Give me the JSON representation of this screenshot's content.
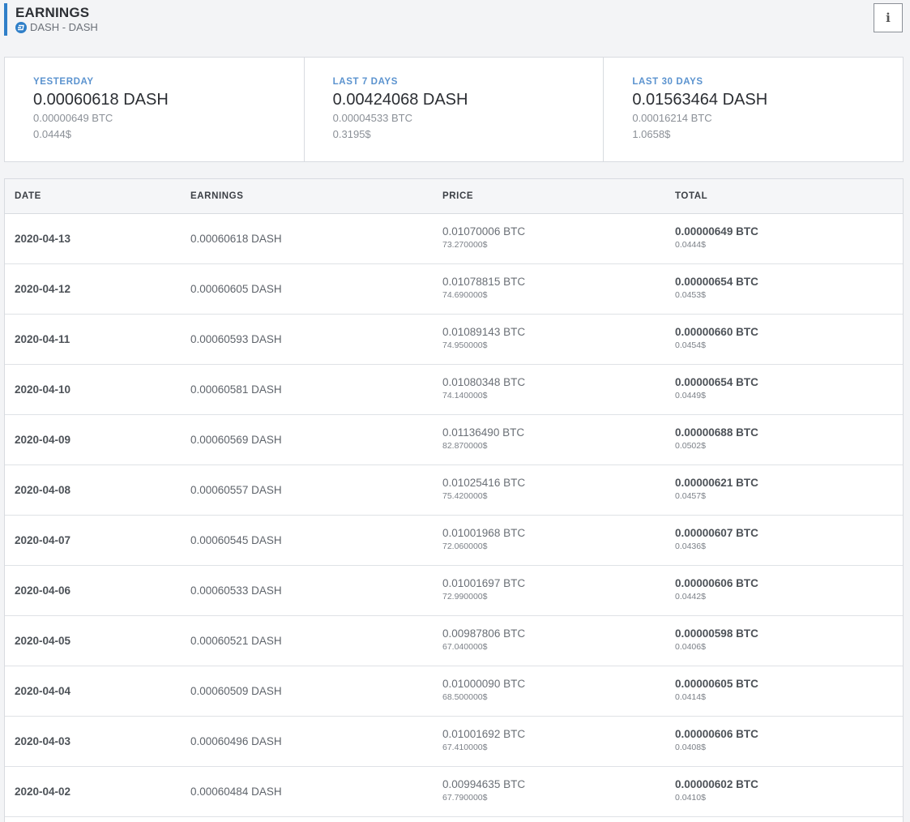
{
  "header": {
    "title": "EARNINGS",
    "subtitle": "DASH - DASH",
    "coin_icon": "dash-coin-icon",
    "info_label": "i",
    "accent_color": "#2f7fc8"
  },
  "stats": [
    {
      "label": "YESTERDAY",
      "amount": "0.00060618 DASH",
      "btc": "0.00000649 BTC",
      "usd": "0.0444$"
    },
    {
      "label": "LAST 7 DAYS",
      "amount": "0.00424068 DASH",
      "btc": "0.00004533 BTC",
      "usd": "0.3195$"
    },
    {
      "label": "LAST 30 DAYS",
      "amount": "0.01563464 DASH",
      "btc": "0.00016214 BTC",
      "usd": "1.0658$"
    }
  ],
  "table": {
    "columns": [
      "DATE",
      "EARNINGS",
      "PRICE",
      "TOTAL"
    ],
    "rows": [
      {
        "date": "2020-04-13",
        "earnings": "0.00060618 DASH",
        "price_btc": "0.01070006 BTC",
        "price_usd": "73.270000$",
        "total_btc": "0.00000649 BTC",
        "total_usd": "0.0444$"
      },
      {
        "date": "2020-04-12",
        "earnings": "0.00060605 DASH",
        "price_btc": "0.01078815 BTC",
        "price_usd": "74.690000$",
        "total_btc": "0.00000654 BTC",
        "total_usd": "0.0453$"
      },
      {
        "date": "2020-04-11",
        "earnings": "0.00060593 DASH",
        "price_btc": "0.01089143 BTC",
        "price_usd": "74.950000$",
        "total_btc": "0.00000660 BTC",
        "total_usd": "0.0454$"
      },
      {
        "date": "2020-04-10",
        "earnings": "0.00060581 DASH",
        "price_btc": "0.01080348 BTC",
        "price_usd": "74.140000$",
        "total_btc": "0.00000654 BTC",
        "total_usd": "0.0449$"
      },
      {
        "date": "2020-04-09",
        "earnings": "0.00060569 DASH",
        "price_btc": "0.01136490 BTC",
        "price_usd": "82.870000$",
        "total_btc": "0.00000688 BTC",
        "total_usd": "0.0502$"
      },
      {
        "date": "2020-04-08",
        "earnings": "0.00060557 DASH",
        "price_btc": "0.01025416 BTC",
        "price_usd": "75.420000$",
        "total_btc": "0.00000621 BTC",
        "total_usd": "0.0457$"
      },
      {
        "date": "2020-04-07",
        "earnings": "0.00060545 DASH",
        "price_btc": "0.01001968 BTC",
        "price_usd": "72.060000$",
        "total_btc": "0.00000607 BTC",
        "total_usd": "0.0436$"
      },
      {
        "date": "2020-04-06",
        "earnings": "0.00060533 DASH",
        "price_btc": "0.01001697 BTC",
        "price_usd": "72.990000$",
        "total_btc": "0.00000606 BTC",
        "total_usd": "0.0442$"
      },
      {
        "date": "2020-04-05",
        "earnings": "0.00060521 DASH",
        "price_btc": "0.00987806 BTC",
        "price_usd": "67.040000$",
        "total_btc": "0.00000598 BTC",
        "total_usd": "0.0406$"
      },
      {
        "date": "2020-04-04",
        "earnings": "0.00060509 DASH",
        "price_btc": "0.01000090 BTC",
        "price_usd": "68.500000$",
        "total_btc": "0.00000605 BTC",
        "total_usd": "0.0414$"
      },
      {
        "date": "2020-04-03",
        "earnings": "0.00060496 DASH",
        "price_btc": "0.01001692 BTC",
        "price_usd": "67.410000$",
        "total_btc": "0.00000606 BTC",
        "total_usd": "0.0408$"
      },
      {
        "date": "2020-04-02",
        "earnings": "0.00060484 DASH",
        "price_btc": "0.00994635 BTC",
        "price_usd": "67.790000$",
        "total_btc": "0.00000602 BTC",
        "total_usd": "0.0410$"
      }
    ]
  }
}
